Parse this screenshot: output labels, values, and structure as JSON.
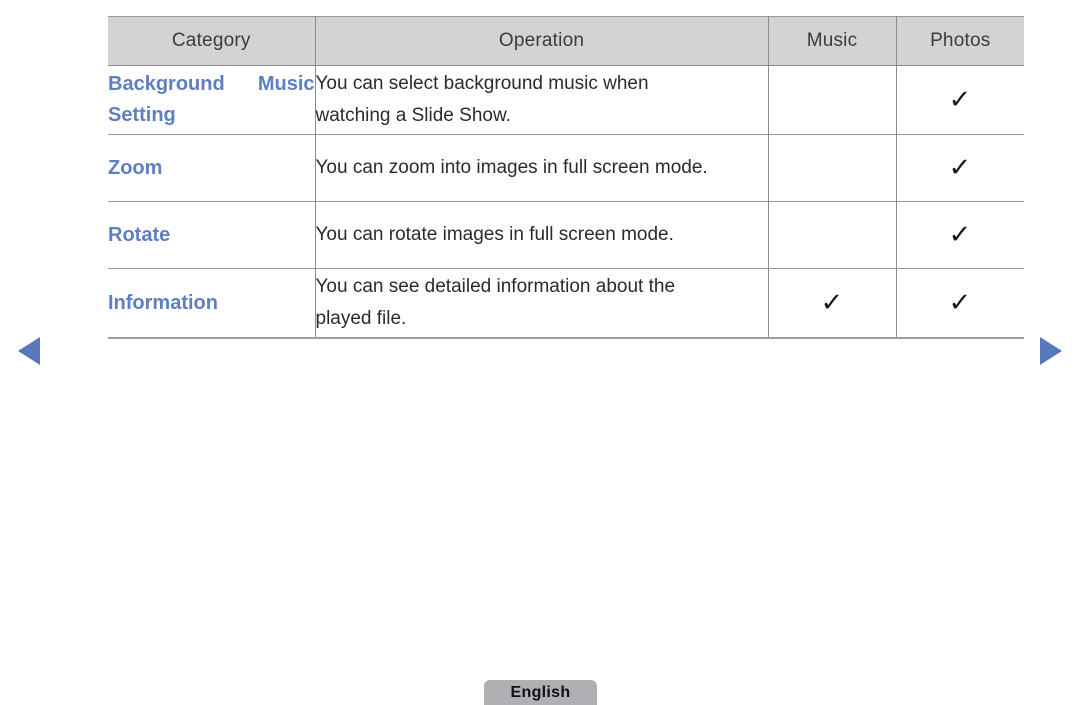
{
  "page": {
    "title": "Media Play feature table",
    "accent_blue": "#5e7fc3",
    "header_bg": "#d2d3d4",
    "border_gray": "#8c8c8c",
    "bottom_border": "#a89a9a"
  },
  "table": {
    "columns": [
      {
        "key": "category",
        "label": "Category"
      },
      {
        "key": "operation",
        "label": "Operation"
      },
      {
        "key": "music",
        "label": "Music"
      },
      {
        "key": "photos",
        "label": "Photos"
      }
    ],
    "rows": [
      {
        "category": "Background Music Setting",
        "category_lines": [
          "Background Music",
          "Setting"
        ],
        "operation": "You can select background music when watching a Slide Show.",
        "operation_lines": [
          "You can select background music when",
          "watching a Slide Show."
        ],
        "music": "",
        "photos": "✓"
      },
      {
        "category": "Zoom",
        "category_lines": [
          "Zoom"
        ],
        "operation": "You can zoom into images in full screen mode.",
        "operation_lines": [
          "You can zoom into images in full screen mode."
        ],
        "music": "",
        "photos": "✓"
      },
      {
        "category": "Rotate",
        "category_lines": [
          "Rotate"
        ],
        "operation": "You can rotate images in full screen mode.",
        "operation_lines": [
          "You can rotate images in full screen mode."
        ],
        "music": "",
        "photos": "✓"
      },
      {
        "category": "Information",
        "category_lines": [
          "Information"
        ],
        "operation": "You can see detailed information about the played file.",
        "operation_lines": [
          "You can see detailed information about the",
          "played file."
        ],
        "music": "✓",
        "photos": "✓"
      }
    ]
  },
  "navigation": {
    "prev_label": "◀",
    "next_label": "▶",
    "prev_icon": "triangle-left-icon",
    "next_icon": "triangle-right-icon"
  },
  "footer": {
    "language_label": "English"
  }
}
